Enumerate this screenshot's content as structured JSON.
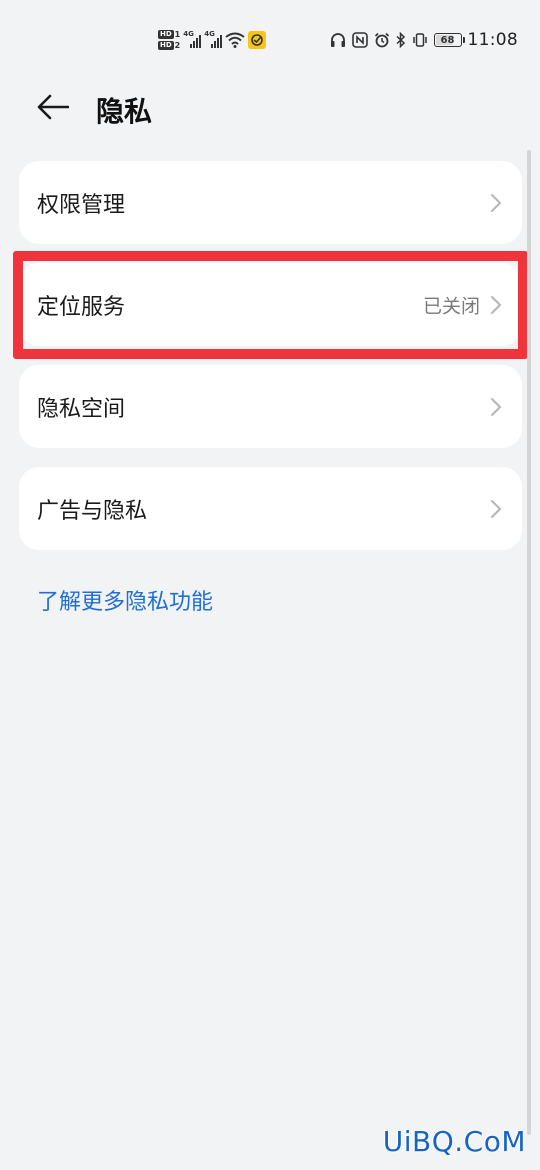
{
  "status_bar": {
    "sim1": {
      "tag": "HD",
      "num": "1"
    },
    "sim2": {
      "tag": "HD",
      "num": "2"
    },
    "signal1_label": "4G",
    "signal2_label": "4G",
    "icons": [
      "hd-icon",
      "signal-icon",
      "wifi-icon",
      "app-notification-icon",
      "headphones-icon",
      "nfc-icon",
      "alarm-icon",
      "bluetooth-icon",
      "vibrate-icon",
      "battery-icon"
    ],
    "battery": "68",
    "battery_level": 0.68,
    "time": "11:08"
  },
  "header": {
    "title": "隐私"
  },
  "items": [
    {
      "label": "权限管理",
      "value": ""
    },
    {
      "label": "定位服务",
      "value": "已关闭"
    },
    {
      "label": "隐私空间",
      "value": ""
    },
    {
      "label": "广告与隐私",
      "value": ""
    }
  ],
  "link": {
    "label": "了解更多隐私功能"
  },
  "watermark": "UiBQ.CoM",
  "colors": {
    "background": "#f1f3f5",
    "card": "#ffffff",
    "link": "#1f6fd6",
    "highlight": "#f0343c",
    "watermark": "#1863c6"
  }
}
